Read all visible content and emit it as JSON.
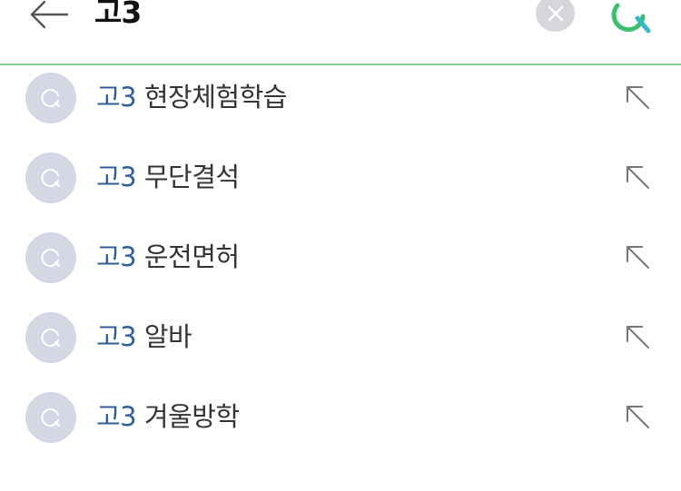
{
  "search": {
    "query": "고3"
  },
  "colors": {
    "accent_line": "#7fcf8f",
    "search_icon_green": "#3dbf6f",
    "search_icon_teal": "#39b7c2",
    "query_highlight": "#2f5f9a",
    "suggestion_text": "#333333",
    "suggestion_icon_bg": "#d4d7e4",
    "clear_button_bg": "#d6d7dc"
  },
  "icons": {
    "back": "arrow-left-icon",
    "clear": "close-icon",
    "search": "search-icon",
    "suggestion": "search-icon",
    "fill": "arrow-up-left-icon"
  },
  "suggestions": [
    {
      "query": "고3",
      "rest": "현장체험학습"
    },
    {
      "query": "고3",
      "rest": "무단결석"
    },
    {
      "query": "고3",
      "rest": "운전면허"
    },
    {
      "query": "고3",
      "rest": "알바"
    },
    {
      "query": "고3",
      "rest": "겨울방학"
    }
  ]
}
